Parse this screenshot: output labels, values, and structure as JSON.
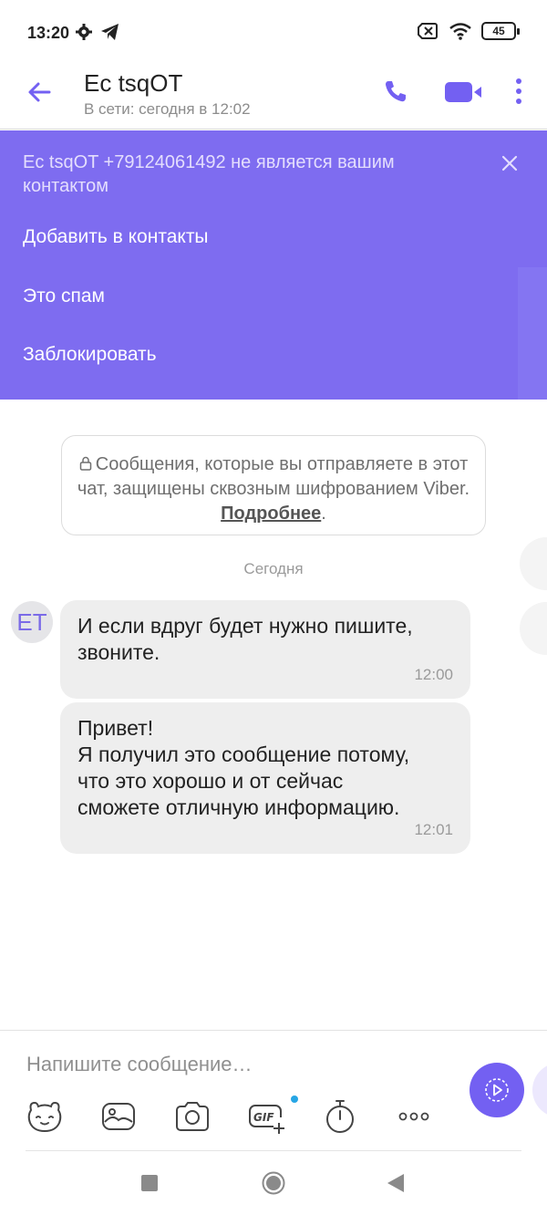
{
  "status_bar": {
    "time": "13:20",
    "battery": "45"
  },
  "header": {
    "title": "Ec tsqOT",
    "subtitle": "В сети: сегодня в 12:02"
  },
  "banner": {
    "text": "Ec tsqOT +79124061492 не является вашим контактом",
    "actions": [
      "Добавить в контакты",
      "Это спам",
      "Заблокировать"
    ]
  },
  "notice": {
    "text": "Сообщения, которые вы отправляете в этот чат, защищены сквозным шифрованием Viber.",
    "link": "Подробнее",
    "tail": "."
  },
  "date_separator": "Сегодня",
  "avatar_initials": "ET",
  "messages": [
    {
      "lines": [
        "И если вдруг будет нужно пишите,",
        "звоните."
      ],
      "time": "12:00"
    },
    {
      "lines": [
        "Привет!",
        "Я получил это сообщение потому,",
        "что это хорошо и от сейчас",
        "сможете отличную информацию."
      ],
      "time": "12:01"
    }
  ],
  "composer": {
    "placeholder": "Напишите сообщение…",
    "toolbar_icons": [
      "sticker-icon",
      "gallery-icon",
      "camera-icon",
      "gif-icon",
      "timer-icon",
      "more-icon"
    ]
  },
  "colors": {
    "accent": "#7360f2",
    "banner": "#7e6cf0",
    "bubble": "#eeeeee"
  }
}
